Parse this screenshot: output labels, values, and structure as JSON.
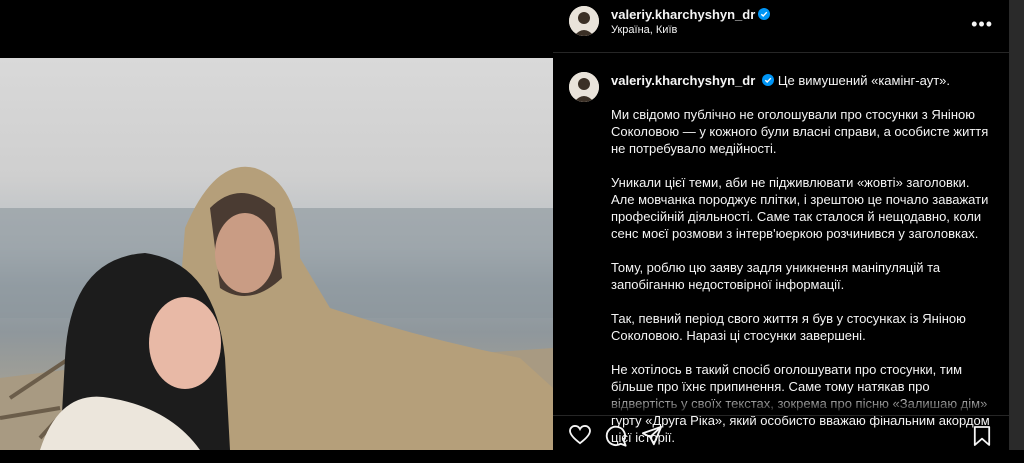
{
  "post": {
    "username": "valeriy.kharchyshyn_dr",
    "location": "Україна, Київ",
    "more_label": "•••",
    "caption_first": "Це вимушений «камінг-аут».",
    "paragraphs": [
      "Ми свідомо публічно не оголошували про стосунки з Яніною Соколовою — у кожного були власні справи, а особисте життя не потребувало медійності.",
      "Уникали цієї теми, аби не підживлювати «жовті» заголовки. Але мовчанка породжує плітки, і зрештою це почало заважати професійній діяльності. Саме так сталося й нещодавно, коли сенс моєї розмови з інтерв'юеркою розчинився у заголовках.",
      "Тому, роблю цю заяву задля уникнення маніпуляцій та запобіганню недостовірної інформації.",
      "Так, певний період свого життя я був у стосунках із Яніною Соколовою. Наразі ці стосунки завершені.",
      "Не хотілось в такий спосіб оголошувати про стосунки, тим більше про їхнє припинення. Саме тому натякав про відвертість у своїх текстах, зокрема про пісню «Залишаю дім» гурту «Друга Ріка», який особисто вважаю фінальним акордом цієї історії."
    ]
  },
  "icons": {
    "like": "heart-icon",
    "comment": "comment-icon",
    "share": "send-icon",
    "save": "bookmark-icon",
    "verified": "verified-badge-icon"
  },
  "colors": {
    "verified_blue": "#0095f6",
    "background": "#000000",
    "text": "#f5f5f5"
  }
}
